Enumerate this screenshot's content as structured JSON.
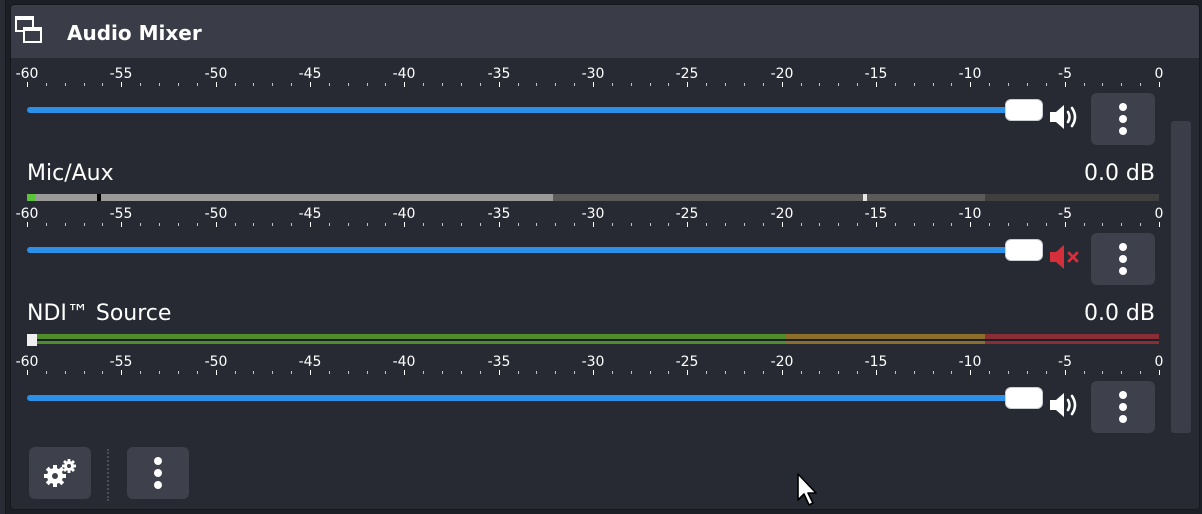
{
  "panel": {
    "title": "Audio Mixer",
    "dock_icon": "dock-window-icon"
  },
  "scale_labels": [
    "-60",
    "-55",
    "-50",
    "-45",
    "-40",
    "-35",
    "-30",
    "-25",
    "-20",
    "-15",
    "-10",
    "-5",
    "0"
  ],
  "channels": [
    {
      "name": "",
      "db": "",
      "volume_fraction": 1.0,
      "muted": false,
      "speaker_icon": "speaker-icon",
      "menu_icon": "vertical-dots-icon"
    },
    {
      "name": "Mic/Aux",
      "db": "0.0 dB",
      "volume_fraction": 1.0,
      "muted": true,
      "speaker_icon": "speaker-muted-icon",
      "menu_icon": "vertical-dots-icon"
    },
    {
      "name": "NDI™ Source",
      "db": "0.0 dB",
      "volume_fraction": 1.0,
      "muted": false,
      "speaker_icon": "speaker-icon",
      "menu_icon": "vertical-dots-icon"
    }
  ],
  "footer": {
    "settings_icon": "gears-icon",
    "menu_icon": "vertical-dots-icon"
  },
  "colors": {
    "accent": "#2c8fe8",
    "muted": "#d42f3a",
    "meter_green": "#4f8d2b",
    "meter_yellow": "#8a6e2a",
    "meter_red": "#8b2d35"
  }
}
